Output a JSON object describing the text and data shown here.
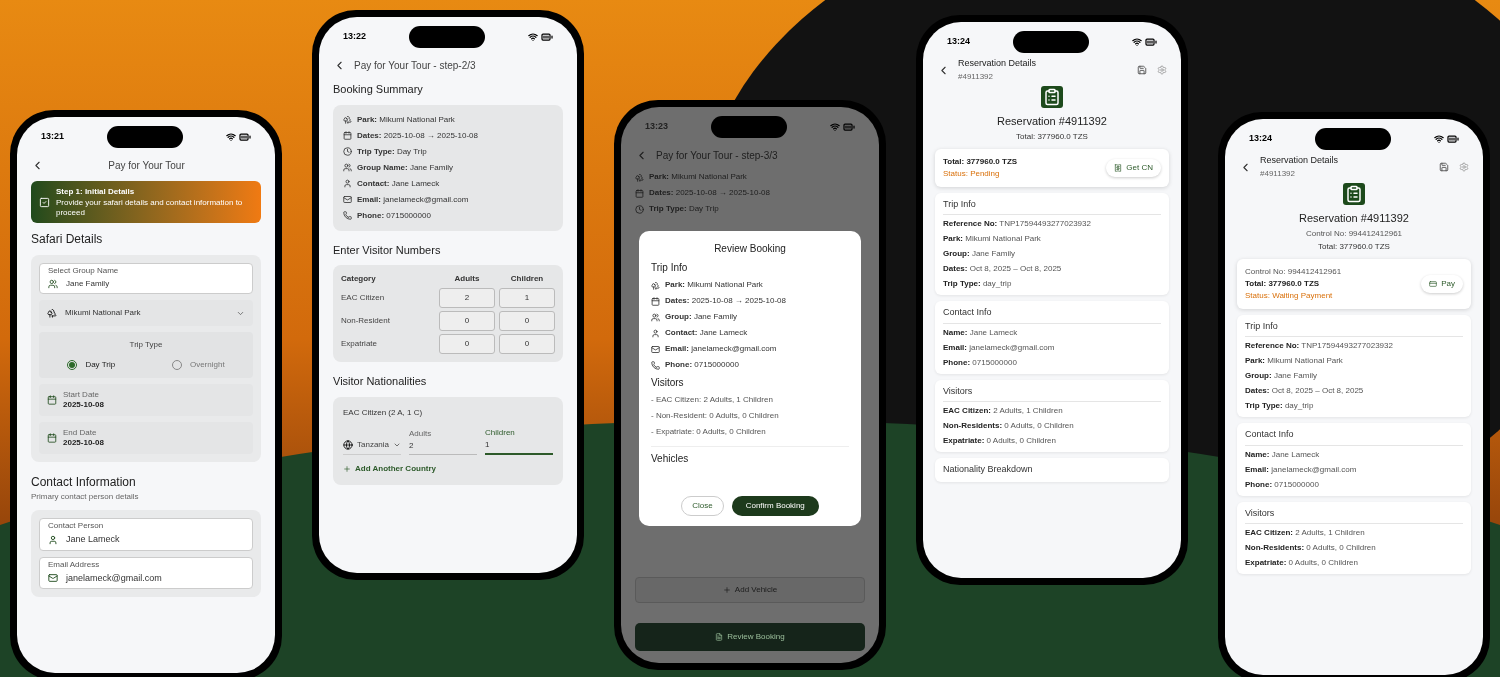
{
  "phones": [
    {
      "kind": "initial",
      "time": "13:21",
      "title": "Pay for Your Tour",
      "banner": {
        "title": "Step 1: Initial Details",
        "text": "Provide your safari details and contact information to proceed"
      },
      "safari": {
        "heading": "Safari Details",
        "group": {
          "label": "Select Group Name",
          "value": "Jane Family"
        },
        "park": "Mikumi National Park",
        "trip_type": {
          "label": "Trip Type",
          "options": [
            {
              "label": "Day Trip",
              "selected": true
            },
            {
              "label": "Overnight",
              "selected": false
            }
          ]
        },
        "dates": [
          {
            "label": "Start Date",
            "value": "2025-10-08"
          },
          {
            "label": "End Date",
            "value": "2025-10-08"
          }
        ]
      },
      "contact": {
        "heading": "Contact Information",
        "subtitle": "Primary contact person details",
        "fields": [
          {
            "kind": "person",
            "label": "Contact Person",
            "value": "Jane Lameck"
          },
          {
            "kind": "email",
            "label": "Email Address",
            "value": "janelameck@gmail.com"
          }
        ]
      }
    },
    {
      "kind": "summary",
      "time": "13:22",
      "title": "Pay for Your Tour - step-2/3",
      "summary": {
        "heading": "Booking Summary",
        "items": [
          {
            "kind": "park",
            "label": "Park:",
            "value": "Mikumi National Park"
          },
          {
            "kind": "dates",
            "label": "Dates:",
            "value": "2025-10-08 → 2025-10-08"
          },
          {
            "kind": "trip",
            "label": "Trip Type:",
            "value": "Day Trip"
          },
          {
            "kind": "group",
            "label": "Group Name:",
            "value": "Jane Family"
          },
          {
            "kind": "person",
            "label": "Contact:",
            "value": "Jane Lameck"
          },
          {
            "kind": "email",
            "label": "Email:",
            "value": "janelameck@gmail.com"
          },
          {
            "kind": "phone",
            "label": "Phone:",
            "value": "0715000000"
          }
        ]
      },
      "numbers": {
        "heading": "Enter Visitor Numbers",
        "columns": [
          "Category",
          "Adults",
          "Children"
        ],
        "rows": [
          {
            "category": "EAC Citizen",
            "adults": "2",
            "children": "1"
          },
          {
            "category": "Non-Resident",
            "adults": "0",
            "children": "0"
          },
          {
            "category": "Expatriate",
            "adults": "0",
            "children": "0"
          }
        ]
      },
      "nationalities": {
        "heading": "Visitor Nationalities",
        "card_title": "EAC Citizen (2 A, 1 C)",
        "country": "Tanzania",
        "adults": {
          "label": "Adults",
          "value": "2"
        },
        "children": {
          "label": "Children",
          "value": "1"
        },
        "add": "Add Another Country"
      }
    },
    {
      "kind": "review",
      "time": "13:23",
      "title": "Pay for Your Tour - step-3/3",
      "background_items": [
        {
          "kind": "park",
          "label": "Park:",
          "value": "Mikumi National Park"
        },
        {
          "kind": "dates",
          "label": "Dates:",
          "value": "2025-10-08 → 2025-10-08"
        },
        {
          "kind": "trip",
          "label": "Trip Type:",
          "value": "Day Trip"
        }
      ],
      "add_vehicle": "Add Vehicle",
      "review_button": "Review Booking",
      "dialog": {
        "title": "Review Booking",
        "trip_heading": "Trip Info",
        "items": [
          {
            "kind": "park",
            "label": "Park:",
            "value": "Mikumi National Park"
          },
          {
            "kind": "dates",
            "label": "Dates:",
            "value": "2025-10-08 → 2025-10-08"
          },
          {
            "kind": "group",
            "label": "Group:",
            "value": "Jane Family"
          },
          {
            "kind": "person",
            "label": "Contact:",
            "value": "Jane Lameck"
          },
          {
            "kind": "email",
            "label": "Email:",
            "value": "janelameck@gmail.com"
          },
          {
            "kind": "phone",
            "label": "Phone:",
            "value": "0715000000"
          }
        ],
        "visitors_heading": "Visitors",
        "visitors": [
          "- EAC Citizen: 2 Adults, 1 Children",
          "- Non-Resident: 0 Adults, 0 Children",
          "- Expatriate: 0 Adults, 0 Children"
        ],
        "vehicles_heading": "Vehicles",
        "buttons": [
          "Close",
          "Confirm Booking"
        ]
      }
    },
    {
      "kind": "reservation",
      "time": "13:24",
      "title": "Reservation Details",
      "subtitle": "#4911392",
      "heading": "Reservation #4911392",
      "total": "Total: 377960.0 TZS",
      "card": {
        "total": "Total: 377960.0 TZS",
        "status": "Status: Pending",
        "action": {
          "kind": "control_number",
          "label": "Get CN"
        }
      },
      "sections": [
        {
          "heading": "Trip Info",
          "rows": [
            {
              "label": "Reference No:",
              "value": "TNP17594493277023932"
            },
            {
              "label": "Park:",
              "value": "Mikumi National Park"
            },
            {
              "label": "Group:",
              "value": "Jane Family"
            },
            {
              "label": "Dates:",
              "value": "Oct 8, 2025 – Oct 8, 2025"
            },
            {
              "label": "Trip Type:",
              "value": "day_trip"
            }
          ]
        },
        {
          "heading": "Contact Info",
          "rows": [
            {
              "label": "Name:",
              "value": "Jane Lameck"
            },
            {
              "label": "Email:",
              "value": "janelameck@gmail.com"
            },
            {
              "label": "Phone:",
              "value": "0715000000"
            }
          ]
        },
        {
          "heading": "Visitors",
          "rows": [
            {
              "label": "EAC Citizen:",
              "value": "2 Adults, 1 Children"
            },
            {
              "label": "Non-Residents:",
              "value": "0 Adults, 0 Children"
            },
            {
              "label": "Expatriate:",
              "value": "0 Adults, 0 Children"
            }
          ]
        },
        {
          "heading": "Nationality Breakdown"
        }
      ]
    },
    {
      "kind": "reservation",
      "time": "13:24",
      "title": "Reservation Details",
      "subtitle": "#4911392",
      "heading": "Reservation #4911392",
      "control": "Control No: 994412412961",
      "total": "Total: 377960.0 TZS",
      "card": {
        "control": "Control No: 994412412961",
        "total": "Total: 377960.0 TZS",
        "status": "Status: Waiting Payment",
        "action": {
          "kind": "pay",
          "label": "Pay"
        }
      },
      "sections": [
        {
          "heading": "Trip Info",
          "rows": [
            {
              "label": "Reference No:",
              "value": "TNP17594493277023932"
            },
            {
              "label": "Park:",
              "value": "Mikumi National Park"
            },
            {
              "label": "Group:",
              "value": "Jane Family"
            },
            {
              "label": "Dates:",
              "value": "Oct 8, 2025 – Oct 8, 2025"
            },
            {
              "label": "Trip Type:",
              "value": "day_trip"
            }
          ]
        },
        {
          "heading": "Contact Info",
          "rows": [
            {
              "label": "Name:",
              "value": "Jane Lameck"
            },
            {
              "label": "Email:",
              "value": "janelameck@gmail.com"
            },
            {
              "label": "Phone:",
              "value": "0715000000"
            }
          ]
        },
        {
          "heading": "Visitors",
          "rows": [
            {
              "label": "EAC Citizen:",
              "value": "2 Adults, 1 Children"
            },
            {
              "label": "Non-Residents:",
              "value": "0 Adults, 0 Children"
            },
            {
              "label": "Expatriate:",
              "value": "0 Adults, 0 Children"
            }
          ]
        }
      ]
    }
  ]
}
